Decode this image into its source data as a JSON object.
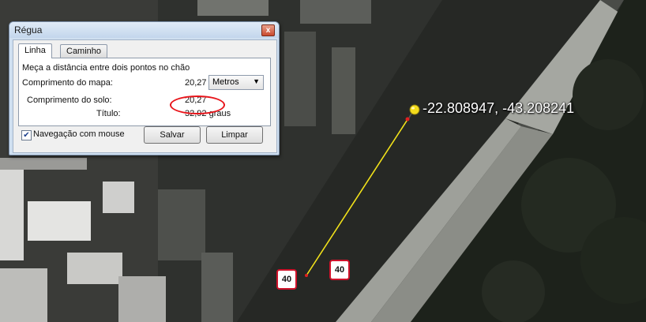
{
  "dialog": {
    "title": "Régua",
    "close_glyph": "x",
    "tabs": [
      {
        "label": "Linha",
        "active": true
      },
      {
        "label": "Caminho",
        "active": false
      }
    ],
    "description": "Meça a distância entre dois pontos no chão",
    "map_length": {
      "label": "Comprimento do mapa:",
      "value": "20,27"
    },
    "unit_select": {
      "selected": "Metros"
    },
    "ground_length": {
      "label": "Comprimento do solo:",
      "value": "20,27"
    },
    "heading": {
      "label": "Título:",
      "value": "32,92 graus"
    },
    "mouse_nav": {
      "label": "Navegação com mouse",
      "checked": true
    },
    "save_label": "Salvar",
    "clear_label": "Limpar"
  },
  "map": {
    "placemark_coordinates": "-22.808947, -43.208241",
    "speed_signs": [
      "40",
      "40"
    ],
    "line_color": "#f2e21a",
    "pin_color": "#f4dc1c"
  },
  "colors": {
    "annotation_circle": "#e8151b",
    "speed_sign_border": "#d0122a"
  }
}
